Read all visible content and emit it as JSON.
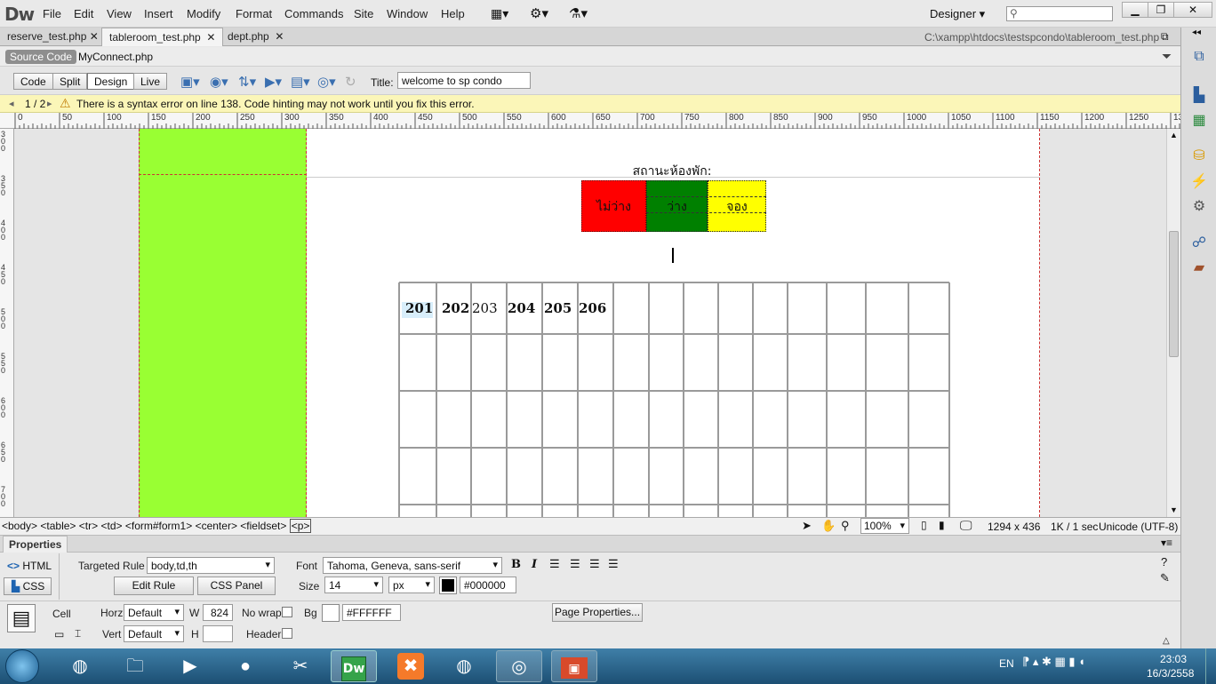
{
  "app": {
    "logo": "Dw"
  },
  "menu": [
    "File",
    "Edit",
    "View",
    "Insert",
    "Modify",
    "Format",
    "Commands",
    "Site",
    "Window",
    "Help"
  ],
  "workspace": {
    "label": "Designer",
    "search_placeholder": ""
  },
  "tabs": [
    {
      "label": "reserve_test.php"
    },
    {
      "label": "tableroom_test.php"
    },
    {
      "label": "dept.php"
    }
  ],
  "file_path": "C:\\xampp\\htdocs\\testspcondo\\tableroom_test.php",
  "related": {
    "source": "Source Code",
    "file": "MyConnect.php"
  },
  "doc_toolbar": {
    "views": [
      "Code",
      "Split",
      "Design",
      "Live"
    ],
    "title_label": "Title:",
    "title_value": "welcome to sp condo"
  },
  "warning": {
    "nav": "1 / 2",
    "text": "There is a syntax error on line 138.  Code hinting may not work until you fix this error."
  },
  "ruler_marks": [
    "0",
    "50",
    "100",
    "150",
    "200",
    "250",
    "300",
    "350",
    "400",
    "450",
    "500",
    "550",
    "600",
    "650",
    "700",
    "750",
    "800",
    "850",
    "900",
    "950",
    "1000",
    "1050",
    "1100",
    "1150",
    "1200",
    "1250",
    "13"
  ],
  "vruler_marks": [
    "300",
    "350",
    "400",
    "450",
    "500",
    "550",
    "600",
    "650",
    "700"
  ],
  "page": {
    "status_heading": "สถานะห้องพัก:",
    "legend": [
      {
        "label": "ไม่ว่าง",
        "color": "#ff0000"
      },
      {
        "label": "ว่าง",
        "color": "#008000"
      },
      {
        "label": "จอง",
        "color": "#ffff00"
      }
    ],
    "rooms": [
      "201",
      "202",
      "203",
      "204",
      "205",
      "206"
    ]
  },
  "tag_selector": [
    "<body>",
    "<table>",
    "<tr>",
    "<td>",
    "<form#form1>",
    "<center>",
    "<fieldset>",
    "<p>"
  ],
  "status": {
    "zoom": "100%",
    "size": "1294 x 436",
    "speed": "1K / 1 sec",
    "encoding": "Unicode (UTF-8)"
  },
  "properties": {
    "title": "Properties",
    "html_label": "HTML",
    "css_label": "CSS",
    "targeted_rule_label": "Targeted Rule",
    "targeted_rule": "body,td,th",
    "edit_rule": "Edit Rule",
    "css_panel": "CSS Panel",
    "font_label": "Font",
    "font": "Tahoma, Geneva, sans-serif",
    "size_label": "Size",
    "size": "14",
    "unit": "px",
    "color": "#000000",
    "cell_label": "Cell",
    "horz_label": "Horz",
    "horz": "Default",
    "vert_label": "Vert",
    "vert": "Default",
    "w_label": "W",
    "w": "824",
    "h_label": "H",
    "h": "",
    "nowrap_label": "No wrap",
    "header_label": "Header",
    "bg_label": "Bg",
    "bg": "#FFFFFF",
    "page_properties": "Page Properties..."
  },
  "taskbar": {
    "lang": "EN",
    "time": "23:03",
    "date": "16/3/2558"
  }
}
